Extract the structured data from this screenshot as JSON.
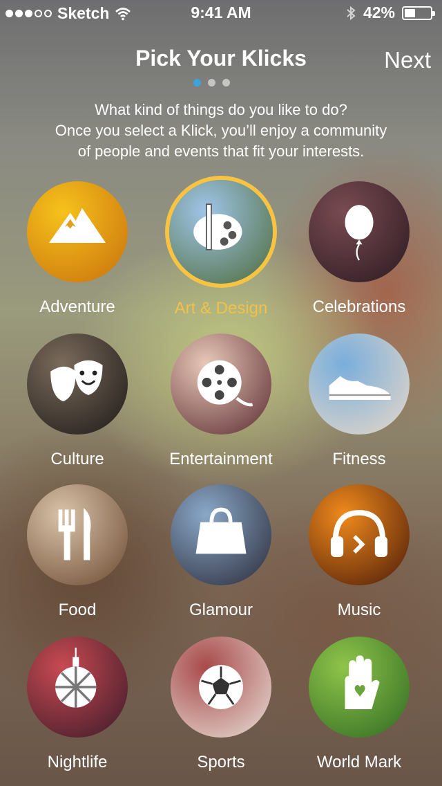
{
  "status": {
    "carrier": "Sketch",
    "time": "9:41 AM",
    "battery_text": "42%",
    "battery_level": 0.42
  },
  "header": {
    "title": "Pick Your Klicks",
    "next_label": "Next"
  },
  "pager": {
    "count": 3,
    "active": 0
  },
  "subtitle": [
    "What kind of things do you like to do?",
    "Once you select a Klick, you’ll enjoy a community",
    "of people and events that fit your interests."
  ],
  "klicks": [
    {
      "label": "Adventure",
      "icon": "mountain-icon",
      "selected": false,
      "c1": "#f6c21c",
      "c2": "#c9700c"
    },
    {
      "label": "Art & Design",
      "icon": "palette-brush-icon",
      "selected": true,
      "c1": "#9fc5e8",
      "c2": "#4d6b3a"
    },
    {
      "label": "Celebrations",
      "icon": "balloon-icon",
      "selected": false,
      "c1": "#7a4b52",
      "c2": "#2a1a20"
    },
    {
      "label": "Culture",
      "icon": "theater-masks-icon",
      "selected": false,
      "c1": "#7a6a5a",
      "c2": "#1d1a18"
    },
    {
      "label": "Entertainment",
      "icon": "film-reel-icon",
      "selected": false,
      "c1": "#e8c8b8",
      "c2": "#5a2a30"
    },
    {
      "label": "Fitness",
      "icon": "sneaker-icon",
      "selected": false,
      "c1": "#79aedb",
      "c2": "#e8d8c8"
    },
    {
      "label": "Food",
      "icon": "fork-knife-icon",
      "selected": false,
      "c1": "#d9c3a8",
      "c2": "#6b4a32"
    },
    {
      "label": "Glamour",
      "icon": "handbag-icon",
      "selected": false,
      "c1": "#8aa8c8",
      "c2": "#2a2a38"
    },
    {
      "label": "Music",
      "icon": "headphones-icon",
      "selected": false,
      "c1": "#f08a1c",
      "c2": "#4a1a08"
    },
    {
      "label": "Nightlife",
      "icon": "disco-ball-icon",
      "selected": false,
      "c1": "#c84a52",
      "c2": "#3a1a28"
    },
    {
      "label": "Sports",
      "icon": "soccer-ball-icon",
      "selected": false,
      "c1": "#a84a4a",
      "c2": "#e8e0d8"
    },
    {
      "label": "World Mark",
      "icon": "heart-hand-icon",
      "selected": false,
      "c1": "#8fc44a",
      "c2": "#2f6a22"
    }
  ]
}
